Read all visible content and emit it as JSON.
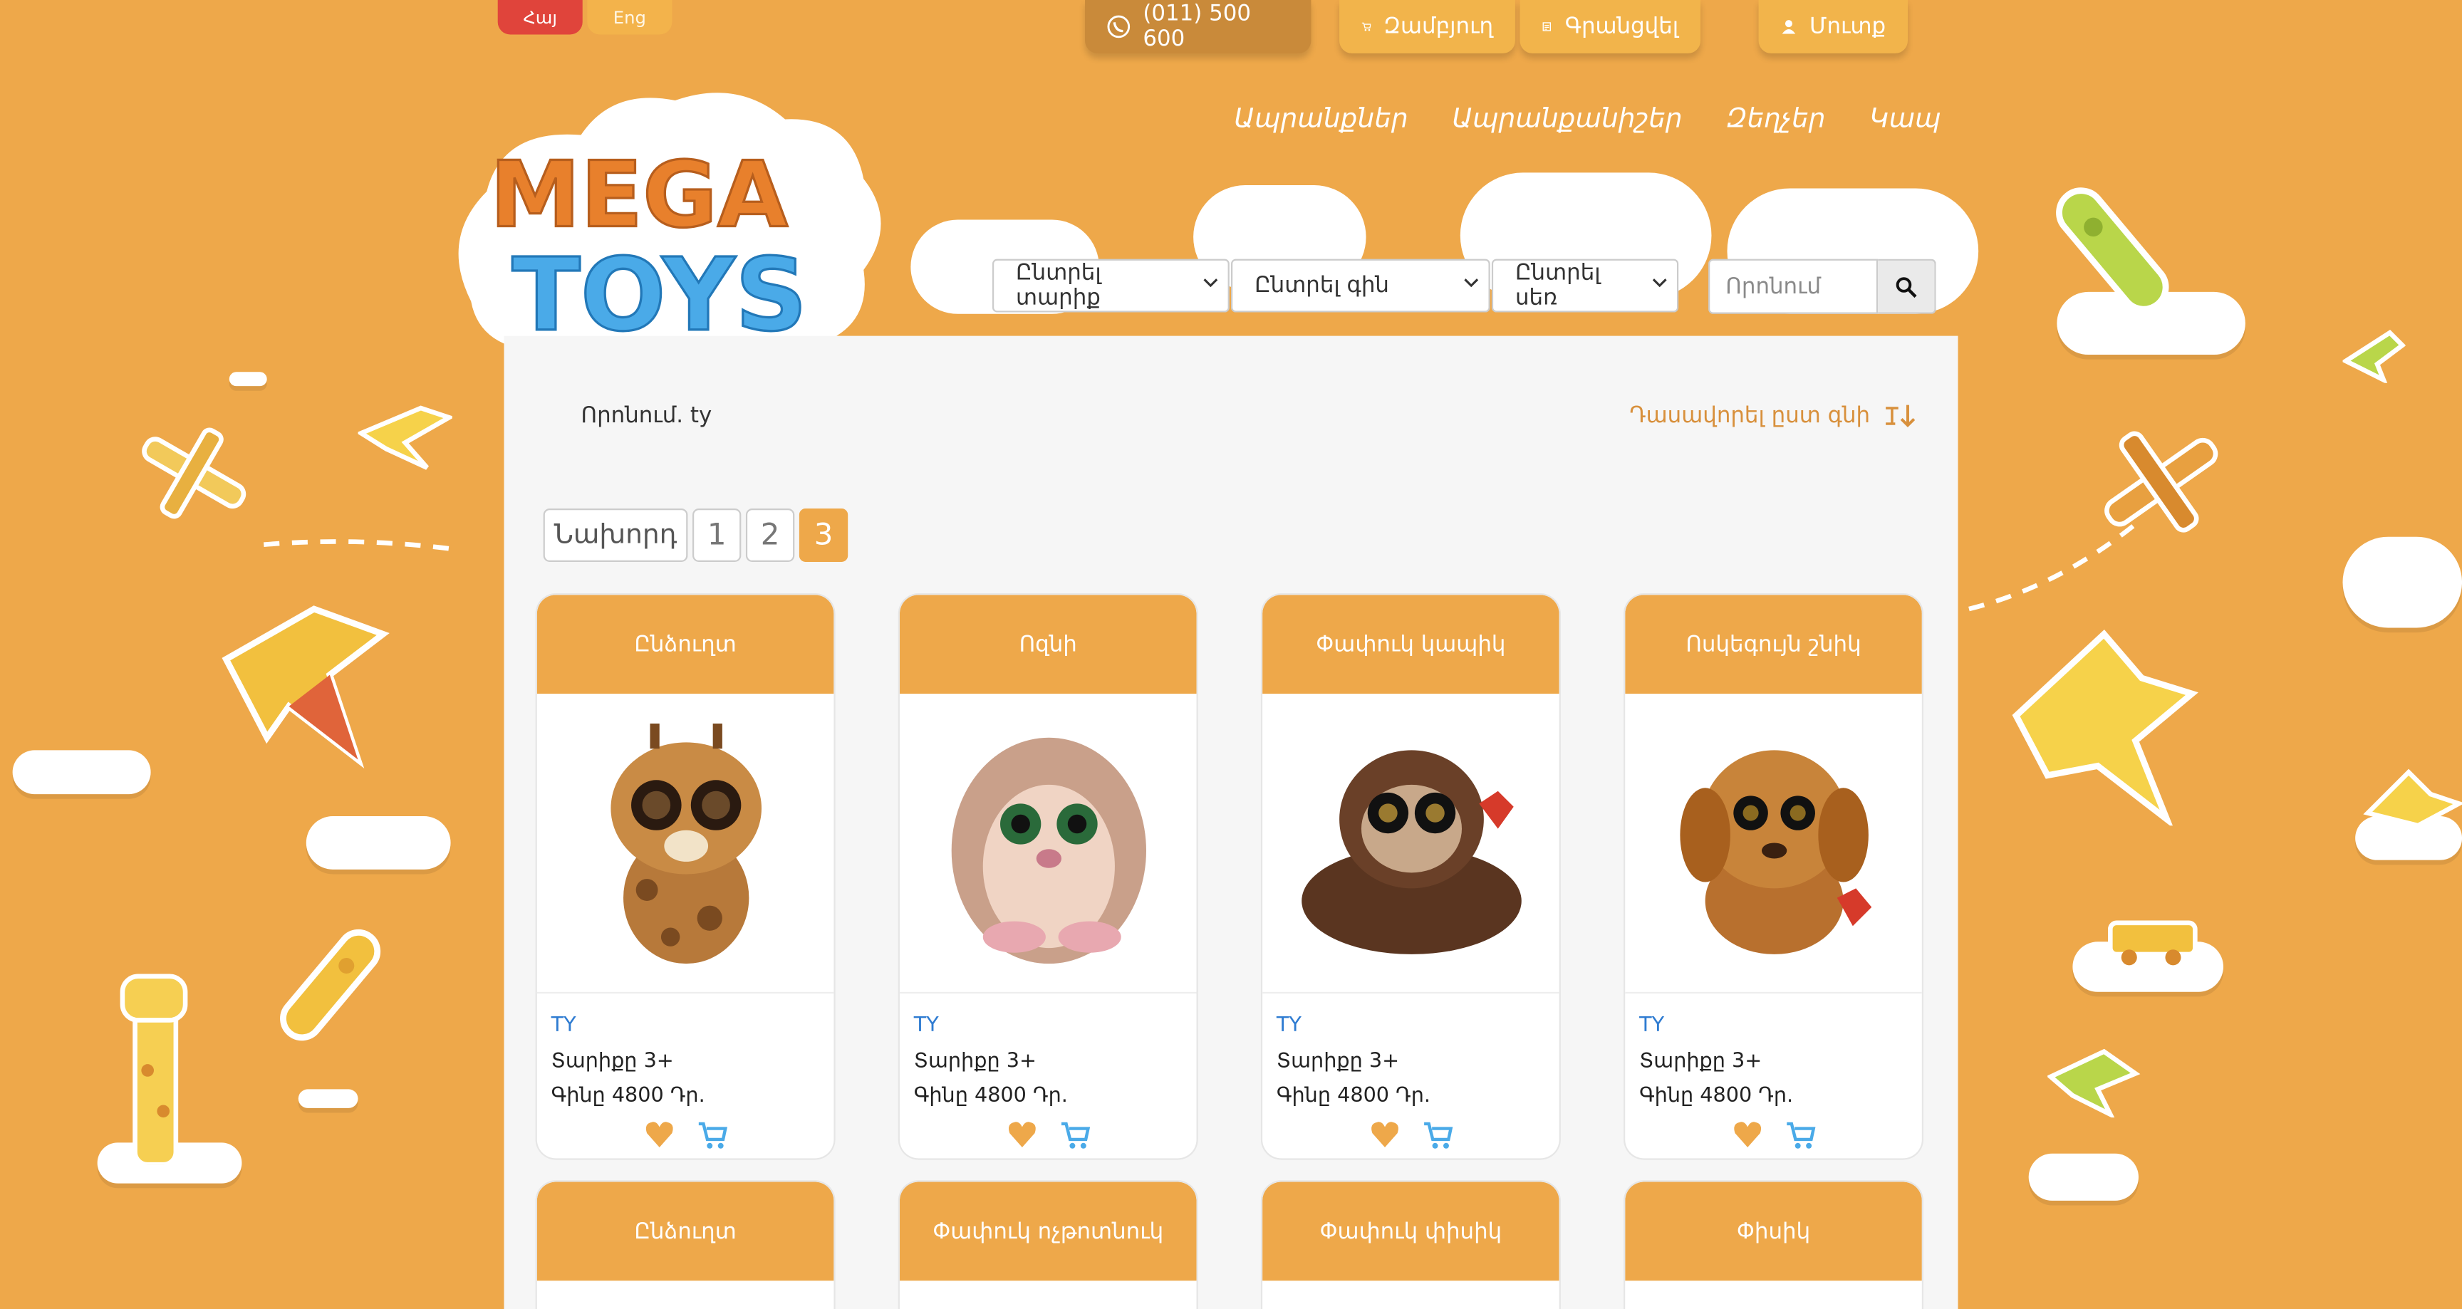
{
  "colors": {
    "brand_orange": "#eea84a",
    "card_header": "#eea84a",
    "lang_active": "#e0443b",
    "link_blue": "#2e7bd1"
  },
  "lang": {
    "hy": "Հայ",
    "en": "Eng"
  },
  "topbar": {
    "phone": "(011) 500 600",
    "cart": "Զամբյուղ",
    "register": "Գրանցվել",
    "login": "Մուտք"
  },
  "nav": [
    "Ապրանքներ",
    "Ապրանքանիշեր",
    "Զեղչեր",
    "Կապ"
  ],
  "logo": {
    "line1": "MEGA",
    "line2": "TOYS"
  },
  "filters": {
    "age": "Ընտրել տարիք",
    "price": "Ընտրել գին",
    "gender": "Ընտրել սեռ",
    "search_placeholder": "Որոնում"
  },
  "results": {
    "query": "Որոնում. ty",
    "sort": "Դասավորել ըստ գնի"
  },
  "pagination": {
    "prev": "Նախորդ",
    "pages": [
      "1",
      "2",
      "3"
    ],
    "current": "3"
  },
  "products": [
    {
      "name": "Ընձուղտ",
      "brand": "TY",
      "age": "Տարիքը 3+",
      "price": "Գինը 4800 Դր.",
      "icon": "giraffe-plush"
    },
    {
      "name": "Ոզնի",
      "brand": "TY",
      "age": "Տարիքը 3+",
      "price": "Գինը 4800 Դր.",
      "icon": "hedgehog-plush"
    },
    {
      "name": "Փափուկ կապիկ",
      "brand": "TY",
      "age": "Տարիքը 3+",
      "price": "Գինը 4800 Դր.",
      "icon": "monkey-plush"
    },
    {
      "name": "Ոսկեգույն շնիկ",
      "brand": "TY",
      "age": "Տարիքը 3+",
      "price": "Գինը 4800 Դր.",
      "icon": "dog-plush"
    }
  ],
  "products_row2": [
    "Ընձուղտ",
    "Փափուկ ոչթոտնուկ",
    "Փափուկ փիսիկ",
    "Փիսիկ"
  ]
}
